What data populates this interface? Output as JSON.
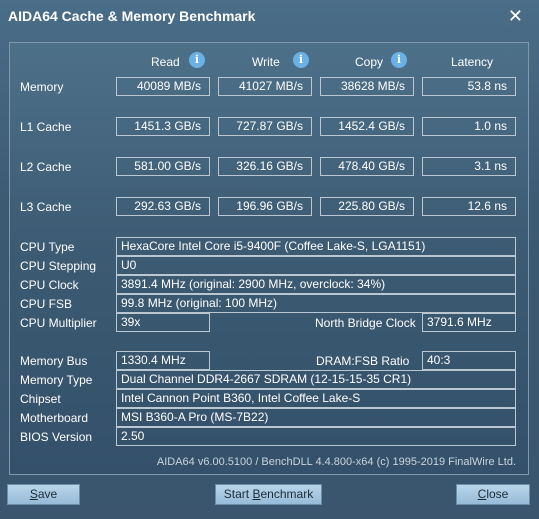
{
  "window": {
    "title": "AIDA64 Cache & Memory Benchmark",
    "close_label": "✕"
  },
  "columns": {
    "read": "Read",
    "write": "Write",
    "copy": "Copy",
    "latency": "Latency"
  },
  "rows": {
    "memory": {
      "label": "Memory",
      "read": "40089 MB/s",
      "write": "41027 MB/s",
      "copy": "38628 MB/s",
      "latency": "53.8 ns"
    },
    "l1": {
      "label": "L1 Cache",
      "read": "1451.3 GB/s",
      "write": "727.87 GB/s",
      "copy": "1452.4 GB/s",
      "latency": "1.0 ns"
    },
    "l2": {
      "label": "L2 Cache",
      "read": "581.00 GB/s",
      "write": "326.16 GB/s",
      "copy": "478.40 GB/s",
      "latency": "3.1 ns"
    },
    "l3": {
      "label": "L3 Cache",
      "read": "292.63 GB/s",
      "write": "196.96 GB/s",
      "copy": "225.80 GB/s",
      "latency": "12.6 ns"
    }
  },
  "info": {
    "cpu_type": {
      "label": "CPU Type",
      "value": "HexaCore Intel Core i5-9400F  (Coffee Lake-S, LGA1151)"
    },
    "cpu_stepping": {
      "label": "CPU Stepping",
      "value": "U0"
    },
    "cpu_clock": {
      "label": "CPU Clock",
      "value": "3891.4 MHz  (original: 2900 MHz, overclock: 34%)"
    },
    "cpu_fsb": {
      "label": "CPU FSB",
      "value": "99.8 MHz  (original: 100 MHz)"
    },
    "cpu_multiplier": {
      "label": "CPU Multiplier",
      "value": "39x"
    },
    "north_bridge_clock": {
      "label": "North Bridge Clock",
      "value": "3791.6 MHz"
    },
    "memory_bus": {
      "label": "Memory Bus",
      "value": "1330.4 MHz"
    },
    "dram_fsb": {
      "label": "DRAM:FSB Ratio",
      "value": "40:3"
    },
    "memory_type": {
      "label": "Memory Type",
      "value": "Dual Channel DDR4-2667 SDRAM  (12-15-15-35 CR1)"
    },
    "chipset": {
      "label": "Chipset",
      "value": "Intel Cannon Point B360, Intel Coffee Lake-S"
    },
    "motherboard": {
      "label": "Motherboard",
      "value": "MSI B360-A Pro (MS-7B22)"
    },
    "bios": {
      "label": "BIOS Version",
      "value": "2.50"
    }
  },
  "footer": "AIDA64 v6.00.5100 / BenchDLL 4.4.800-x64  (c) 1995-2019 FinalWire Ltd.",
  "buttons": {
    "save_pre": "",
    "save_ul": "S",
    "save_post": "ave",
    "start_pre": "Start ",
    "start_ul": "B",
    "start_post": "enchmark",
    "close_pre": "",
    "close_ul": "C",
    "close_post": "lose"
  }
}
